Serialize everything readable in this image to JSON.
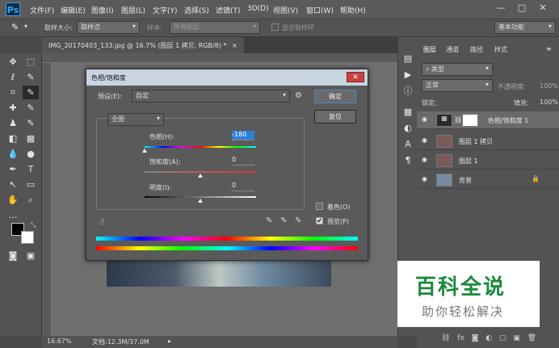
{
  "menubar": {
    "logo": "Ps",
    "items": [
      "文件(F)",
      "编辑(E)",
      "图像(I)",
      "图层(L)",
      "文字(Y)",
      "选择(S)",
      "滤镜(T)",
      "3D(D)",
      "视图(V)",
      "窗口(W)",
      "帮助(H)"
    ],
    "min": "—",
    "max": "□",
    "close": "✕"
  },
  "options": {
    "sample_size_label": "取样大小:",
    "sample_size_value": "取样点",
    "sample_label": "样本:",
    "sample_value": "所有图层",
    "show_ring": "显示取样环",
    "workspace": "基本功能"
  },
  "doc": {
    "tab_title": "IMG_20170403_133.jpg @ 16.7% (图层 1 拷贝, RGB/8) *",
    "tab_close": "×",
    "zoom": "16.67%",
    "doc_info": "文档:12.3M/37.0M"
  },
  "dialog": {
    "title": "色相/饱和度",
    "preset_label": "预设(E):",
    "preset_value": "自定",
    "channel": "全图",
    "hue_label": "色相(H):",
    "hue_value": "-180",
    "sat_label": "饱和度(A):",
    "sat_value": "0",
    "light_label": "明度(I):",
    "light_value": "0",
    "ok": "确定",
    "reset": "复位",
    "colorize": "着色(O)",
    "preview": "预览(P)"
  },
  "panels": {
    "tabs": [
      "图层",
      "通道",
      "路径",
      "样式"
    ],
    "kind": "类型",
    "blend": "正常",
    "opacity_label": "不透明度:",
    "opacity": "100%",
    "lock_label": "锁定:",
    "fill_label": "填充:",
    "fill": "100%"
  },
  "layers": [
    {
      "name": "色相/饱和度 1"
    },
    {
      "name": "图层 1 拷贝"
    },
    {
      "name": "图层 1"
    },
    {
      "name": "背景"
    }
  ],
  "watermark": {
    "title": "百科全说",
    "subtitle": "助你轻松解决"
  },
  "colors": {
    "accent": "#2e7fd6",
    "watermark_green": "#1a8a3a"
  }
}
